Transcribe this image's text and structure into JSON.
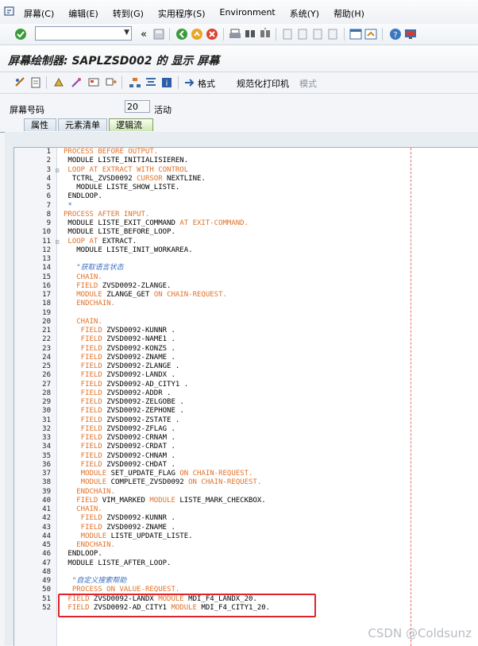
{
  "menubar": {
    "items": [
      "屏幕(C)",
      "编辑(E)",
      "转到(G)",
      "实用程序(S)",
      "Environment",
      "系统(Y)",
      "帮助(H)"
    ]
  },
  "toolbar": {
    "command_value": ""
  },
  "title": "屏幕绘制器: SAPLZSD002 的 显示 屏幕",
  "app_toolbar": {
    "format_label": "格式",
    "normalize_label": "规范化打印机",
    "mode_label": "模式"
  },
  "screen": {
    "label": "屏幕号码",
    "number": "20",
    "status": "活动"
  },
  "tabs": [
    "属性",
    "元素清单",
    "逻辑流"
  ],
  "code_lines": [
    {
      "n": "1",
      "f": "",
      "t": [
        [
          "kw",
          "PROCESS BEFORE OUTPUT."
        ]
      ]
    },
    {
      "n": "2",
      "f": "",
      "t": [
        [
          "plain",
          " MODULE LISTE_INITIALISIEREN."
        ]
      ]
    },
    {
      "n": "3",
      "f": "⊟",
      "t": [
        [
          "kw",
          " LOOP AT EXTRACT WITH CONTROL"
        ]
      ]
    },
    {
      "n": "4",
      "f": "",
      "t": [
        [
          "plain",
          "  TCTRL_ZVSD0092 "
        ],
        [
          "kw",
          "CURSOR"
        ],
        [
          "plain",
          " NEXTLINE."
        ]
      ]
    },
    {
      "n": "5",
      "f": "",
      "t": [
        [
          "plain",
          "   MODULE LISTE_SHOW_LISTE."
        ]
      ]
    },
    {
      "n": "6",
      "f": "",
      "t": [
        [
          "plain",
          " ENDLOOP."
        ]
      ]
    },
    {
      "n": "7",
      "f": "",
      "t": [
        [
          "cmt",
          " *"
        ]
      ]
    },
    {
      "n": "8",
      "f": "",
      "t": [
        [
          "kw",
          "PROCESS AFTER INPUT."
        ]
      ]
    },
    {
      "n": "9",
      "f": "",
      "t": [
        [
          "plain",
          " MODULE LISTE_EXIT_COMMAND "
        ],
        [
          "kw",
          "AT EXIT-COMMAND."
        ]
      ]
    },
    {
      "n": "10",
      "f": "",
      "t": [
        [
          "plain",
          " MODULE LISTE_BEFORE_LOOP."
        ]
      ]
    },
    {
      "n": "11",
      "f": "⊟",
      "t": [
        [
          "kw",
          " LOOP AT"
        ],
        [
          "plain",
          " EXTRACT."
        ]
      ]
    },
    {
      "n": "12",
      "f": "",
      "t": [
        [
          "plain",
          "   MODULE LISTE_INIT_WORKAREA."
        ]
      ]
    },
    {
      "n": "13",
      "f": "",
      "t": [
        [
          "plain",
          ""
        ]
      ]
    },
    {
      "n": "14",
      "f": "",
      "t": [
        [
          "cmt",
          "   \"获取语言状态"
        ]
      ]
    },
    {
      "n": "15",
      "f": "",
      "t": [
        [
          "kw",
          "   CHAIN."
        ]
      ]
    },
    {
      "n": "16",
      "f": "",
      "t": [
        [
          "kw",
          "   FIELD"
        ],
        [
          "plain",
          " ZVSD0092-ZLANGE."
        ]
      ]
    },
    {
      "n": "17",
      "f": "",
      "t": [
        [
          "kw",
          "   MODULE"
        ],
        [
          "plain",
          " ZLANGE_GET "
        ],
        [
          "kw",
          "ON CHAIN-REQUEST."
        ]
      ]
    },
    {
      "n": "18",
      "f": "",
      "t": [
        [
          "kw",
          "   ENDCHAIN."
        ]
      ]
    },
    {
      "n": "19",
      "f": "",
      "t": [
        [
          "plain",
          ""
        ]
      ]
    },
    {
      "n": "20",
      "f": "",
      "t": [
        [
          "kw",
          "   CHAIN."
        ]
      ]
    },
    {
      "n": "21",
      "f": "",
      "t": [
        [
          "kw",
          "    FIELD"
        ],
        [
          "plain",
          " ZVSD0092-KUNNR ."
        ]
      ]
    },
    {
      "n": "22",
      "f": "",
      "t": [
        [
          "kw",
          "    FIELD"
        ],
        [
          "plain",
          " ZVSD0092-NAME1 ."
        ]
      ]
    },
    {
      "n": "23",
      "f": "",
      "t": [
        [
          "kw",
          "    FIELD"
        ],
        [
          "plain",
          " ZVSD0092-KONZS ."
        ]
      ]
    },
    {
      "n": "24",
      "f": "",
      "t": [
        [
          "kw",
          "    FIELD"
        ],
        [
          "plain",
          " ZVSD0092-ZNAME ."
        ]
      ]
    },
    {
      "n": "25",
      "f": "",
      "t": [
        [
          "kw",
          "    FIELD"
        ],
        [
          "plain",
          " ZVSD0092-ZLANGE ."
        ]
      ]
    },
    {
      "n": "26",
      "f": "",
      "t": [
        [
          "kw",
          "    FIELD"
        ],
        [
          "plain",
          " ZVSD0092-LANDX ."
        ]
      ]
    },
    {
      "n": "27",
      "f": "",
      "t": [
        [
          "kw",
          "    FIELD"
        ],
        [
          "plain",
          " ZVSD0092-AD_CITY1 ."
        ]
      ]
    },
    {
      "n": "28",
      "f": "",
      "t": [
        [
          "kw",
          "    FIELD"
        ],
        [
          "plain",
          " ZVSD0092-ADDR ."
        ]
      ]
    },
    {
      "n": "29",
      "f": "",
      "t": [
        [
          "kw",
          "    FIELD"
        ],
        [
          "plain",
          " ZVSD0092-ZELGOBE ."
        ]
      ]
    },
    {
      "n": "30",
      "f": "",
      "t": [
        [
          "kw",
          "    FIELD"
        ],
        [
          "plain",
          " ZVSD0092-ZEPHONE ."
        ]
      ]
    },
    {
      "n": "31",
      "f": "",
      "t": [
        [
          "kw",
          "    FIELD"
        ],
        [
          "plain",
          " ZVSD0092-ZSTATE ."
        ]
      ]
    },
    {
      "n": "32",
      "f": "",
      "t": [
        [
          "kw",
          "    FIELD"
        ],
        [
          "plain",
          " ZVSD0092-ZFLAG ."
        ]
      ]
    },
    {
      "n": "33",
      "f": "",
      "t": [
        [
          "kw",
          "    FIELD"
        ],
        [
          "plain",
          " ZVSD0092-CRNAM ."
        ]
      ]
    },
    {
      "n": "34",
      "f": "",
      "t": [
        [
          "kw",
          "    FIELD"
        ],
        [
          "plain",
          " ZVSD0092-CRDAT ."
        ]
      ]
    },
    {
      "n": "35",
      "f": "",
      "t": [
        [
          "kw",
          "    FIELD"
        ],
        [
          "plain",
          " ZVSD0092-CHNAM ."
        ]
      ]
    },
    {
      "n": "36",
      "f": "",
      "t": [
        [
          "kw",
          "    FIELD"
        ],
        [
          "plain",
          " ZVSD0092-CHDAT ."
        ]
      ]
    },
    {
      "n": "37",
      "f": "",
      "t": [
        [
          "kw",
          "    MODULE"
        ],
        [
          "plain",
          " SET_UPDATE_FLAG "
        ],
        [
          "kw",
          "ON CHAIN-REQUEST."
        ]
      ]
    },
    {
      "n": "38",
      "f": "",
      "t": [
        [
          "kw",
          "    MODULE"
        ],
        [
          "plain",
          " COMPLETE_ZVSD0092 "
        ],
        [
          "kw",
          "ON CHAIN-REQUEST."
        ]
      ]
    },
    {
      "n": "39",
      "f": "",
      "t": [
        [
          "kw",
          "   ENDCHAIN."
        ]
      ]
    },
    {
      "n": "40",
      "f": "",
      "t": [
        [
          "kw",
          "   FIELD"
        ],
        [
          "plain",
          " VIM_MARKED "
        ],
        [
          "kw",
          "MODULE"
        ],
        [
          "plain",
          " LISTE_MARK_CHECKBOX."
        ]
      ]
    },
    {
      "n": "41",
      "f": "",
      "t": [
        [
          "kw",
          "   CHAIN."
        ]
      ]
    },
    {
      "n": "42",
      "f": "",
      "t": [
        [
          "kw",
          "    FIELD"
        ],
        [
          "plain",
          " ZVSD0092-KUNNR ."
        ]
      ]
    },
    {
      "n": "43",
      "f": "",
      "t": [
        [
          "kw",
          "    FIELD"
        ],
        [
          "plain",
          " ZVSD0092-ZNAME ."
        ]
      ]
    },
    {
      "n": "44",
      "f": "",
      "t": [
        [
          "kw",
          "    MODULE"
        ],
        [
          "plain",
          " LISTE_UPDATE_LISTE."
        ]
      ]
    },
    {
      "n": "45",
      "f": "",
      "t": [
        [
          "kw",
          "   ENDCHAIN."
        ]
      ]
    },
    {
      "n": "46",
      "f": "",
      "t": [
        [
          "plain",
          " ENDLOOP."
        ]
      ]
    },
    {
      "n": "47",
      "f": "",
      "t": [
        [
          "plain",
          " MODULE LISTE_AFTER_LOOP."
        ]
      ]
    },
    {
      "n": "48",
      "f": "",
      "t": [
        [
          "plain",
          ""
        ]
      ]
    },
    {
      "n": "49",
      "f": "",
      "t": [
        [
          "cmt",
          "  \"自定义搜索帮助"
        ]
      ]
    },
    {
      "n": "50",
      "f": "",
      "t": [
        [
          "kw",
          "  PROCESS ON VALUE-REQUEST."
        ]
      ]
    },
    {
      "n": "51",
      "f": "",
      "t": [
        [
          "kw",
          " FIELD"
        ],
        [
          "plain",
          " ZVSD0092-LANDX "
        ],
        [
          "kw",
          "MODULE"
        ],
        [
          "plain",
          " MDI_F4_LANDX_20."
        ]
      ]
    },
    {
      "n": "52",
      "f": "",
      "t": [
        [
          "kw",
          " FIELD"
        ],
        [
          "plain",
          " ZVSD0092-AD_CITY1 "
        ],
        [
          "kw",
          "MODULE"
        ],
        [
          "plain",
          " MDI_F4_CITY1_20."
        ]
      ]
    }
  ],
  "watermark": "CSDN @Coldsunz",
  "colors": {
    "keyword": "#e0722a",
    "comment": "#3c6fbf",
    "highlight": "#e0242a"
  }
}
